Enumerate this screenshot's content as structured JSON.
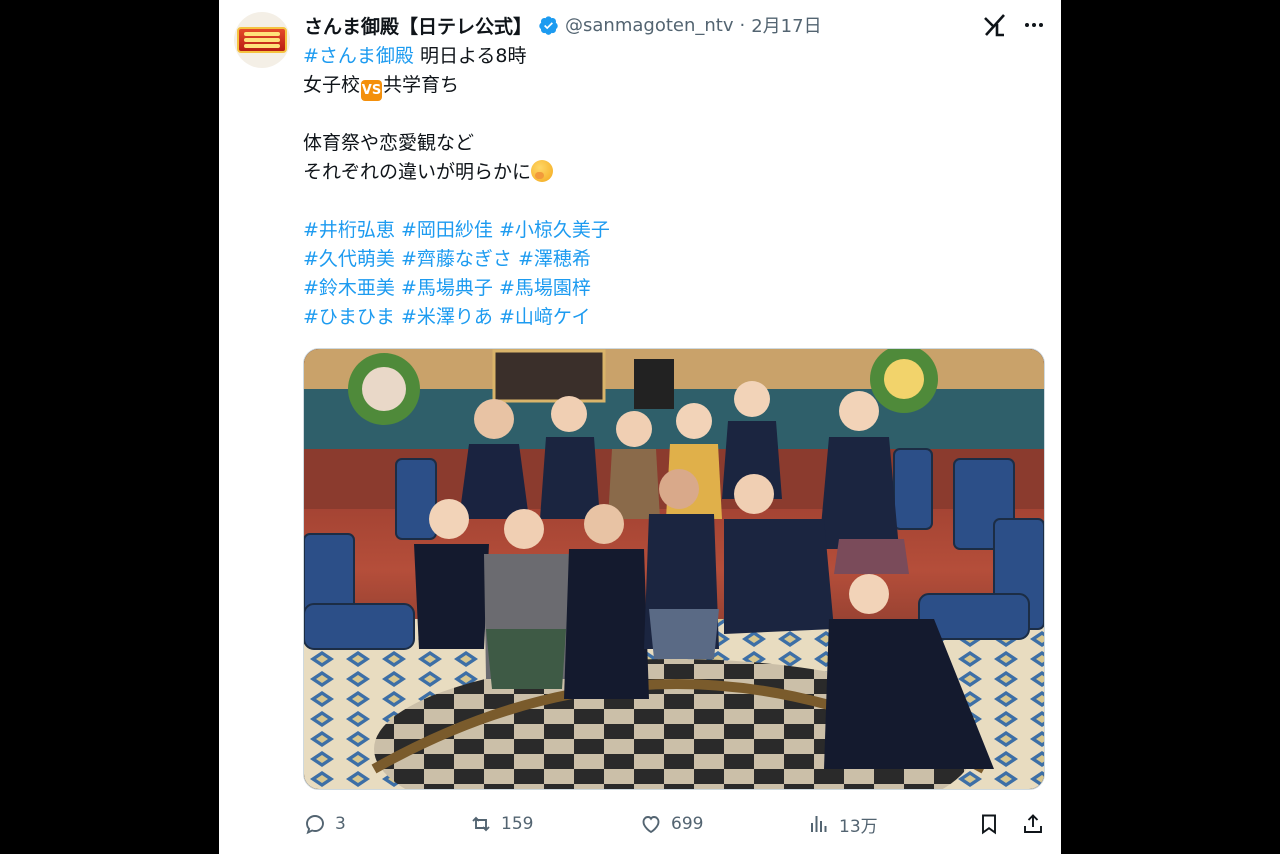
{
  "account": {
    "name": "さんま御殿【日テレ公式】",
    "handle": "@sanmagoten_ntv",
    "separator": "·",
    "date": "2月17日"
  },
  "post": {
    "line1_tag": "#さんま御殿",
    "line1_text": " 明日よる8時",
    "line2_before": "女子校",
    "line2_vs": "VS",
    "line2_after": "共学育ち",
    "line3": "体育祭や恋愛観など",
    "line4": "それぞれの違いが明らかに",
    "hashtags": [
      [
        "#井桁弘恵",
        "#岡田紗佳",
        "#小椋久美子"
      ],
      [
        "#久代萌美",
        "#齊藤なぎさ",
        "#澤穂希"
      ],
      [
        "#鈴木亜美",
        "#馬場典子",
        "#馬場園梓"
      ],
      [
        "#ひまひま",
        "#米澤りあ",
        "#山﨑ケイ"
      ]
    ]
  },
  "image": {
    "photo": "group photo of twelve women in school uniforms on a TV studio set"
  },
  "metrics": {
    "replies": "3",
    "reposts": "159",
    "likes": "699",
    "views": "13万"
  },
  "icons": {
    "verified": "verified-badge-icon",
    "grok": "grok-icon",
    "more": "more-icon",
    "reply": "reply-icon",
    "repost": "repost-icon",
    "like": "like-icon",
    "views": "views-icon",
    "bookmark": "bookmark-icon",
    "share": "share-icon"
  },
  "colors": {
    "link": "#1d9bf0",
    "verified": "#1d9bf0",
    "text": "#0f1419",
    "secondary": "#536471"
  }
}
